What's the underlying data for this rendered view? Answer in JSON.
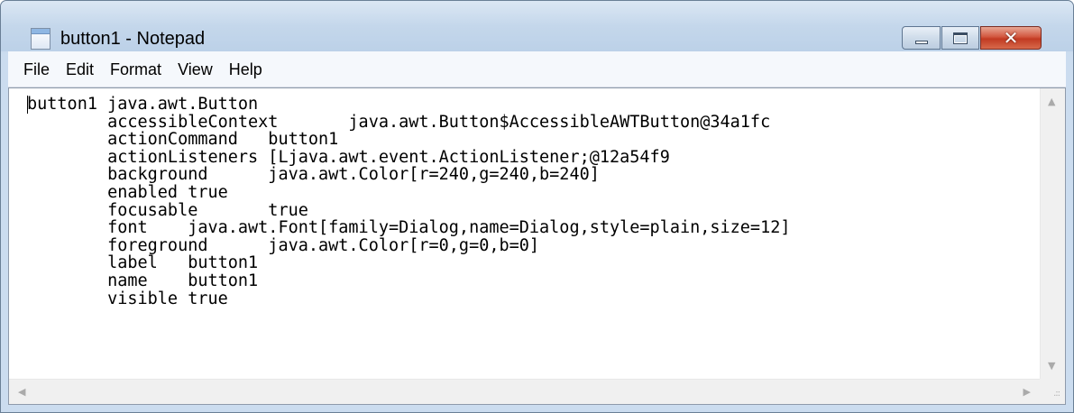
{
  "window": {
    "title": "button1 - Notepad",
    "icon": "notepad-icon",
    "controls": {
      "minimize_icon": "minimize-icon",
      "maximize_icon": "maximize-icon",
      "close_icon": "close-icon",
      "close_glyph": "✕",
      "close_color": "#c23a22"
    }
  },
  "menubar": {
    "items": [
      "File",
      "Edit",
      "Format",
      "View",
      "Help"
    ]
  },
  "editor": {
    "lines": [
      "button1 java.awt.Button",
      "        accessibleContext       java.awt.Button$AccessibleAWTButton@34a1fc",
      "        actionCommand   button1",
      "        actionListeners [Ljava.awt.event.ActionListener;@12a54f9",
      "        background      java.awt.Color[r=240,g=240,b=240]",
      "        enabled true",
      "        focusable       true",
      "        font    java.awt.Font[family=Dialog,name=Dialog,style=plain,size=12]",
      "        foreground      java.awt.Color[r=0,g=0,b=0]",
      "        label   button1",
      "        name    button1",
      "        visible true"
    ]
  },
  "scrollbars": {
    "up_glyph": "▲",
    "down_glyph": "▼",
    "left_glyph": "◀",
    "right_glyph": "▶",
    "grip_glyph": ".::"
  }
}
